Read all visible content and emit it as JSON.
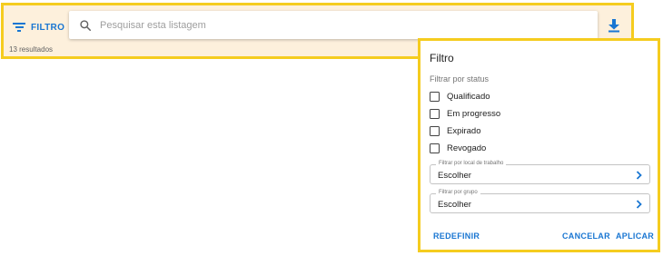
{
  "toolbar": {
    "filter_label": "FILTRO",
    "search_placeholder": "Pesquisar esta listagem",
    "search_value": "",
    "results_text": "13 resultados"
  },
  "filter_panel": {
    "title": "Filtro",
    "status_heading": "Filtrar por status",
    "statuses": [
      {
        "label": "Qualificado",
        "checked": false
      },
      {
        "label": "Em progresso",
        "checked": false
      },
      {
        "label": "Expirado",
        "checked": false
      },
      {
        "label": "Revogado",
        "checked": false
      }
    ],
    "workplace_field": {
      "legend": "Filtrar por local de trabalho",
      "value": "Escolher"
    },
    "group_field": {
      "legend": "Filtrar por grupo",
      "value": "Escolher"
    },
    "reset_label": "REDEFINIR",
    "cancel_label": "CANCELAR",
    "apply_label": "APLICAR"
  },
  "icons": {
    "filter": "filter-list-icon",
    "search": "search-icon",
    "download": "download-icon",
    "chevron": "chevron-right-icon",
    "checkbox": "checkbox-unchecked-icon"
  },
  "colors": {
    "accent": "#1976d2",
    "highlight_border": "#f5cc1f",
    "toolbar_background": "#fdf0dc"
  }
}
